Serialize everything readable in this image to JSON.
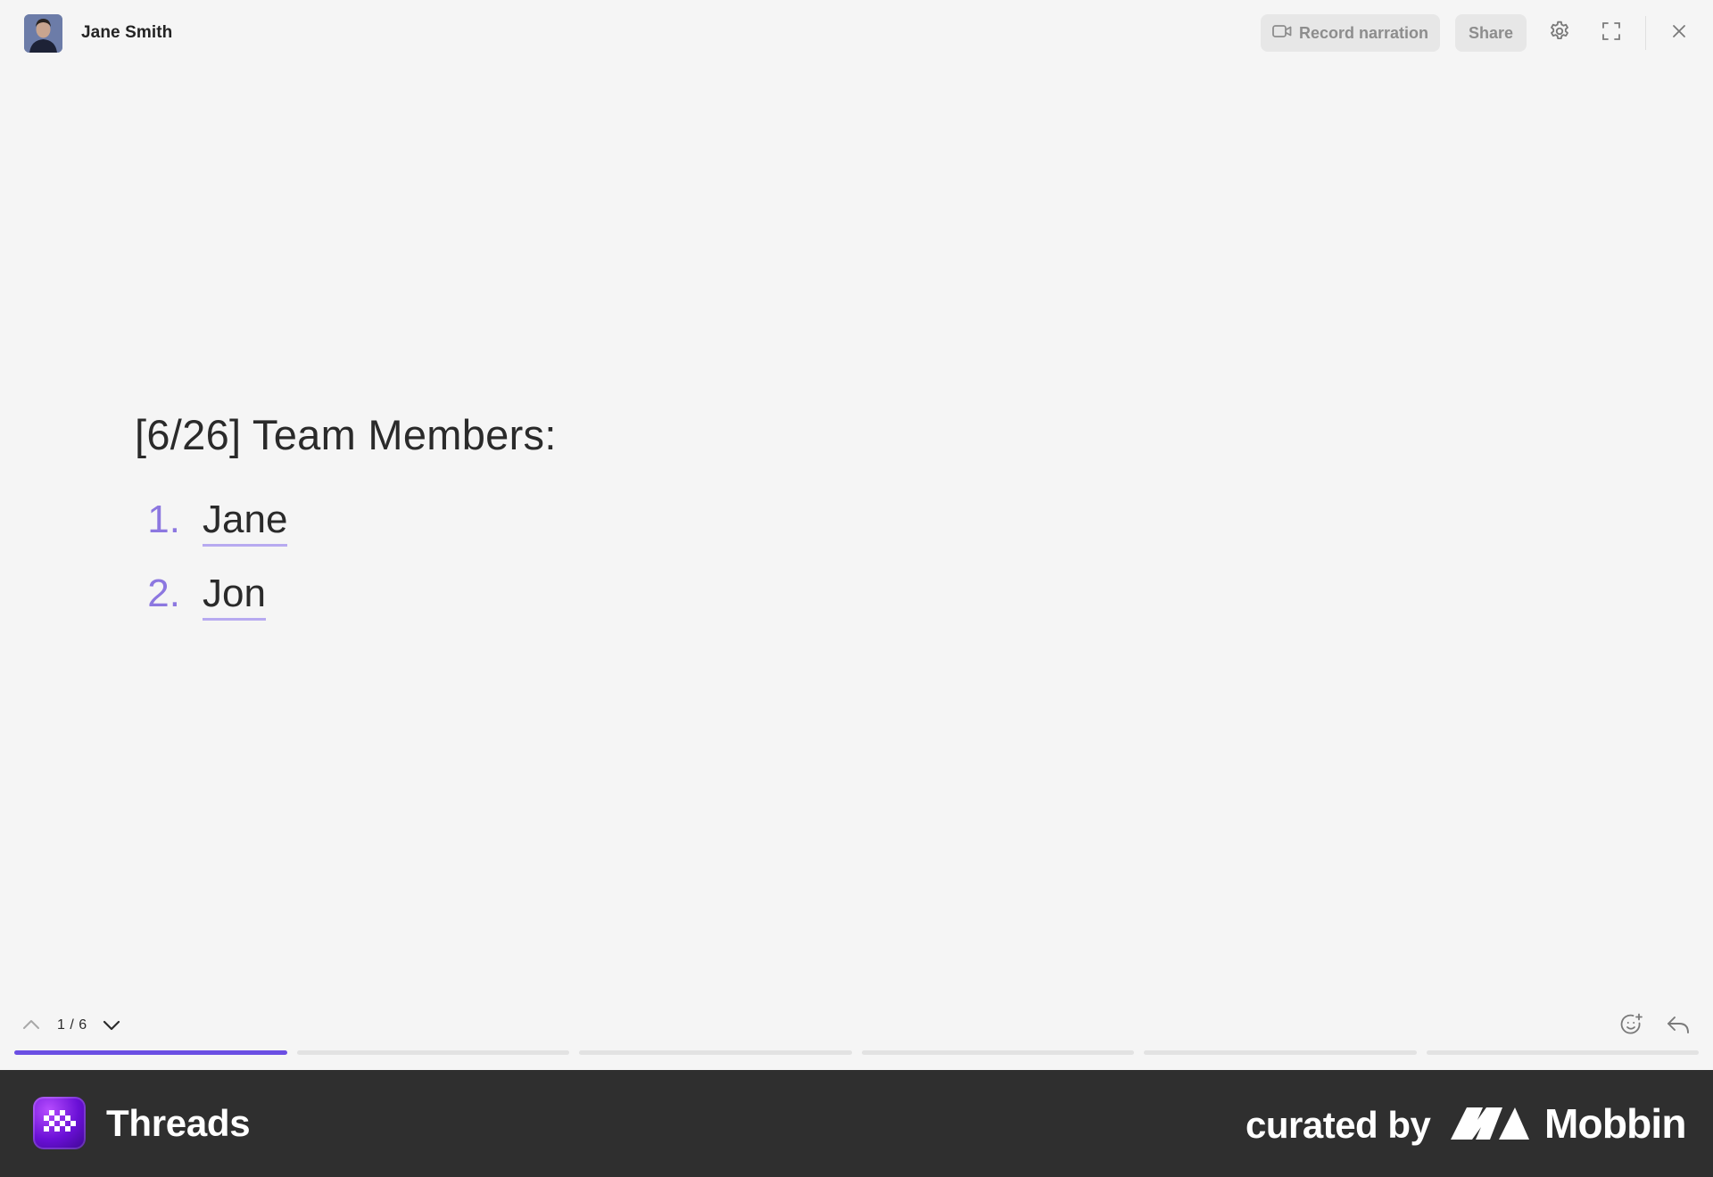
{
  "header": {
    "author_name": "Jane Smith",
    "record_label": "Record narration",
    "share_label": "Share"
  },
  "content": {
    "title": "[6/26] Team Members:",
    "members": [
      {
        "number": "1.",
        "name": "Jane"
      },
      {
        "number": "2.",
        "name": "Jon"
      }
    ]
  },
  "footer": {
    "page_counter": "1 / 6",
    "progress": {
      "current": 1,
      "total": 6
    }
  },
  "banner": {
    "app_name": "Threads",
    "curated_label": "curated by",
    "brand_name": "Mobbin"
  },
  "icons": {
    "record": "video-camera-icon",
    "settings": "gear-icon",
    "fullscreen": "expand-icon",
    "close": "close-icon",
    "prev": "chevron-up-icon",
    "next": "chevron-down-icon",
    "reaction": "add-emoji-icon",
    "reply": "reply-icon"
  },
  "colors": {
    "accent": "#6b4fe3",
    "list_number": "#8c77e0",
    "underline": "#b7aaf0",
    "banner_bg": "#2f2f2f"
  }
}
